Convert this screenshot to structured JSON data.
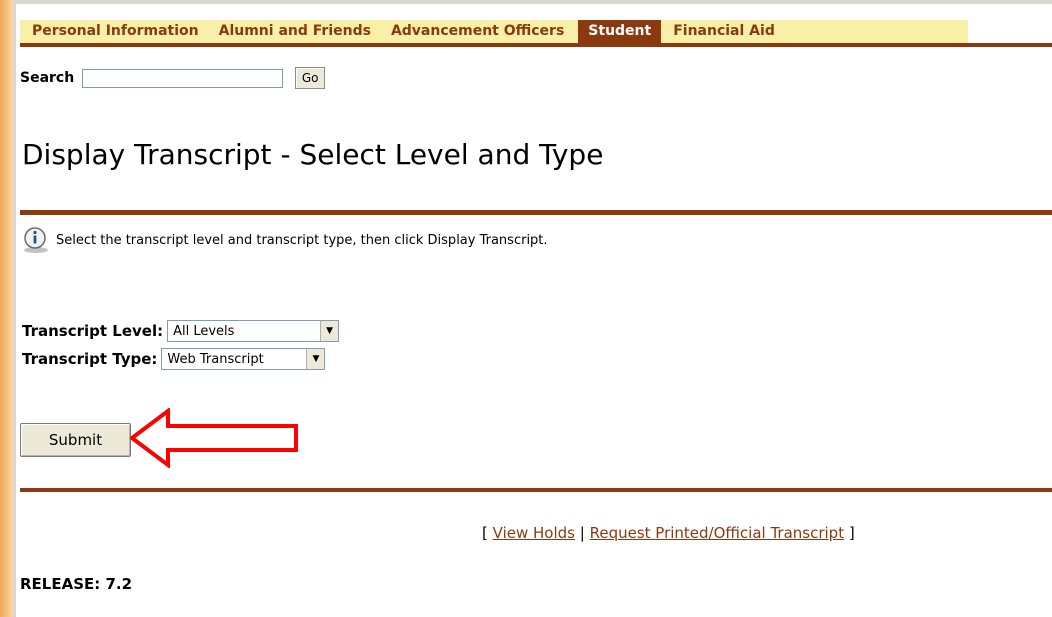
{
  "nav": {
    "tabs": [
      {
        "label": "Personal Information",
        "active": false
      },
      {
        "label": "Alumni and Friends",
        "active": false
      },
      {
        "label": "Advancement Officers",
        "active": false
      },
      {
        "label": "Student",
        "active": true
      },
      {
        "label": "Financial Aid",
        "active": false
      }
    ]
  },
  "search": {
    "label": "Search",
    "value": "",
    "go_label": "Go"
  },
  "page": {
    "title": "Display Transcript - Select Level and Type",
    "info": "Select the transcript level and transcript type, then click Display Transcript.",
    "info_icon": "info-icon"
  },
  "form": {
    "level_label": "Transcript Level:",
    "level_value": "All Levels",
    "type_label": "Transcript Type:",
    "type_value": "Web Transcript",
    "submit_label": "Submit"
  },
  "annotation": {
    "arrow_color": "#ff0000",
    "arrow_icon": "arrow-left-icon"
  },
  "footer": {
    "open_bracket": "[",
    "separator": "|",
    "close_bracket": "]",
    "link1": "View Holds",
    "link2": "Request Printed/Official Transcript",
    "release": "RELEASE: 7.2"
  },
  "colors": {
    "accent": "#8a3a0e",
    "tab_bg": "#f7f0a6",
    "strip": "#f3a75a"
  }
}
